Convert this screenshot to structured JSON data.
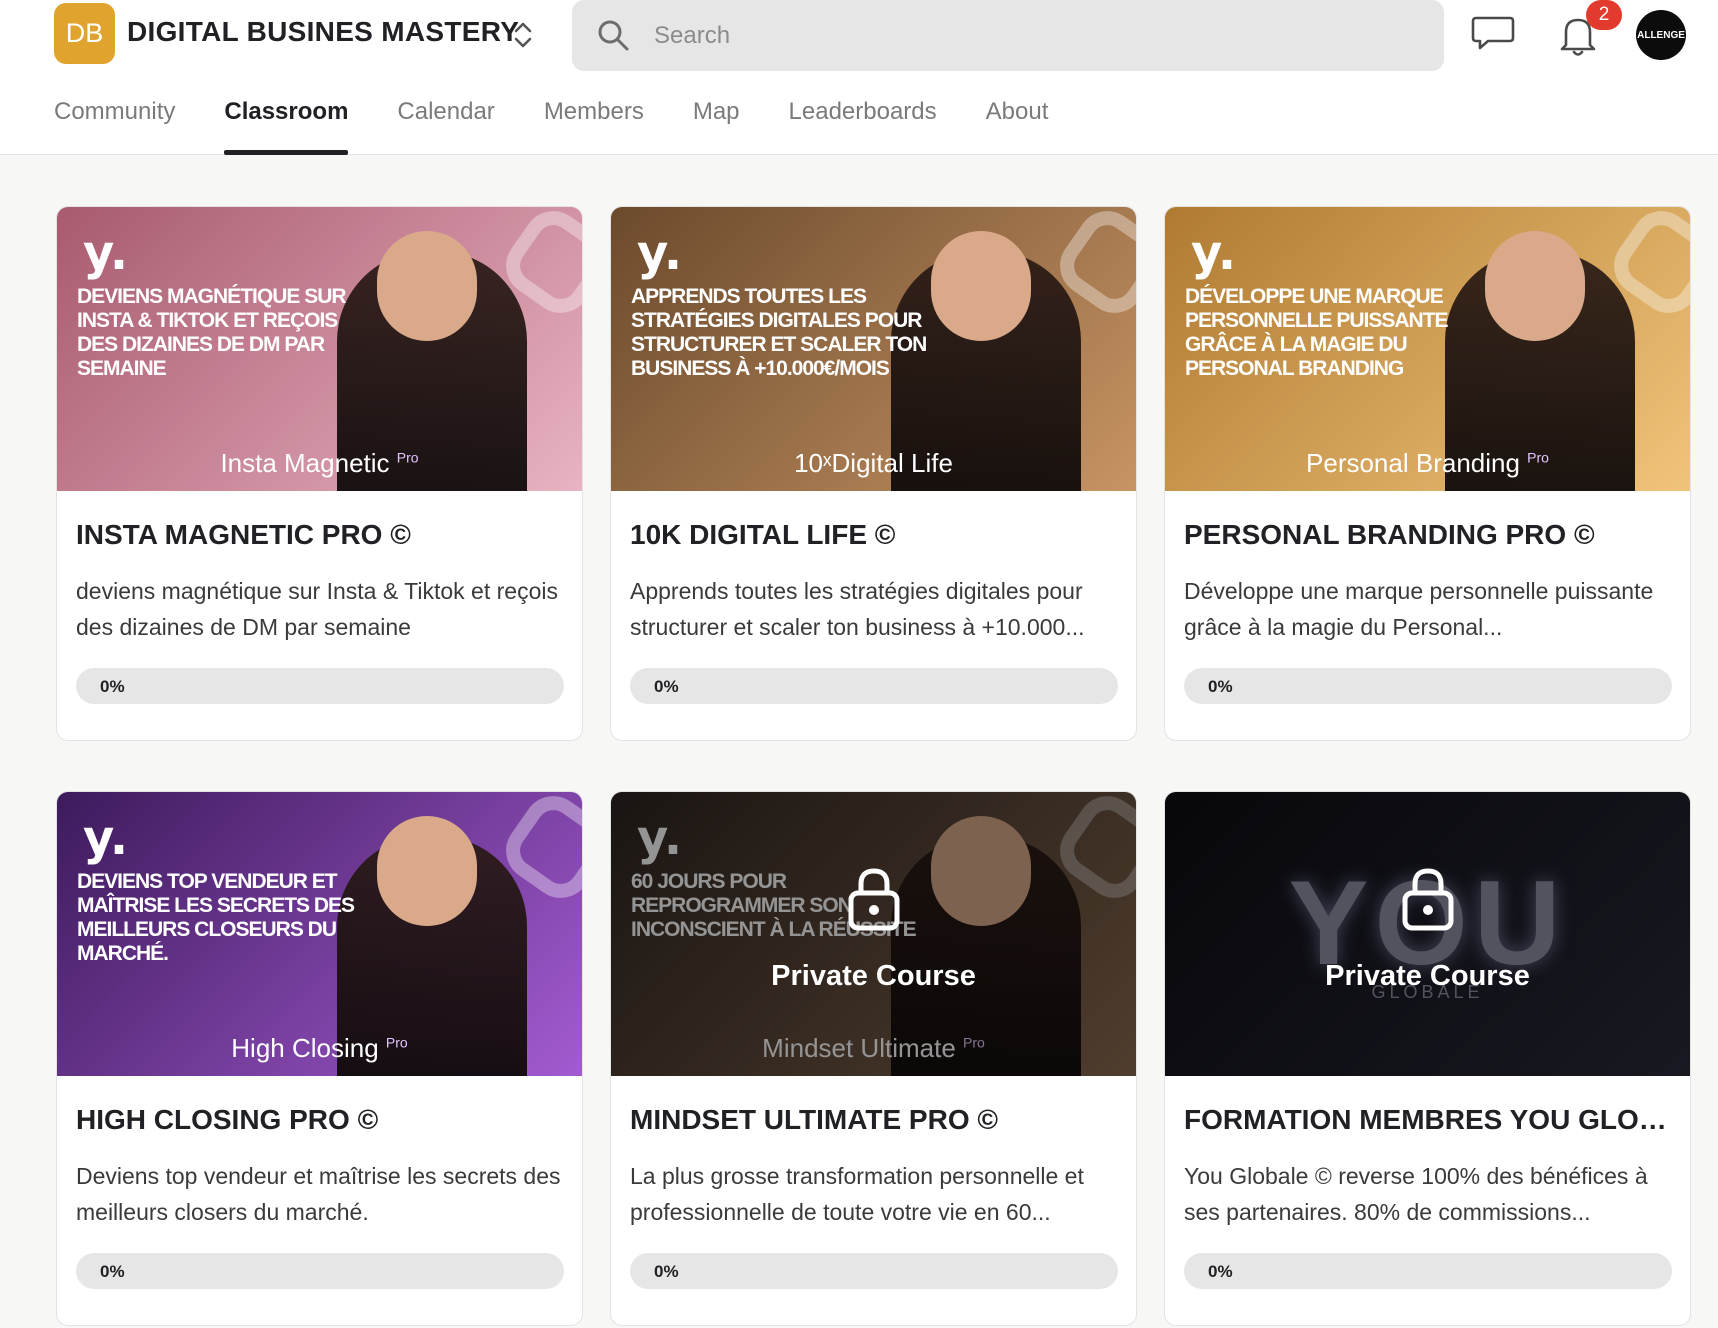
{
  "header": {
    "logo_initials": "DB",
    "group_name": "DIGITAL BUSINES MASTERY",
    "search_placeholder": "Search",
    "notification_count": "2",
    "avatar_text": "ALLENGE"
  },
  "tabs": [
    {
      "label": "Community",
      "active": false
    },
    {
      "label": "Classroom",
      "active": true
    },
    {
      "label": "Calendar",
      "active": false
    },
    {
      "label": "Members",
      "active": false
    },
    {
      "label": "Map",
      "active": false
    },
    {
      "label": "Leaderboards",
      "active": false
    },
    {
      "label": "About",
      "active": false
    }
  ],
  "courses": [
    {
      "title": "INSTA MAGNETIC PRO ©",
      "description": "deviens magnétique sur Insta & Tiktok et reçois des dizaines de DM par semaine",
      "progress_label": "0%",
      "progress": 0,
      "cover_headline": "DEVIENS MAGNÉTIQUE SUR INSTA & TIKTOK ET REÇOIS DES DIZAINES DE DM PAR SEMAINE",
      "cover_product": "Insta Magnetic",
      "cover_product_sup": "Pro",
      "cover_brand": "y.",
      "locked": false,
      "gradient": [
        "#a85a6e",
        "#e8b3c2"
      ]
    },
    {
      "title": "10K DIGITAL LIFE ©",
      "description": "Apprends toutes les stratégies digitales pour structurer et scaler ton business à +10.000...",
      "progress_label": "0%",
      "progress": 0,
      "cover_headline": "APPRENDS TOUTES LES STRATÉGIES DIGITALES POUR STRUCTURER ET SCALER TON BUSINESS À +10.000€/MOIS",
      "cover_product": "10ˣDigital Life",
      "cover_product_sup": "",
      "cover_brand": "y.",
      "locked": false,
      "gradient": [
        "#6b4a2c",
        "#c79464"
      ]
    },
    {
      "title": "PERSONAL BRANDING PRO ©",
      "description": "Développe une marque personnelle puissante grâce à la magie du Personal...",
      "progress_label": "0%",
      "progress": 0,
      "cover_headline": "DÉVELOPPE UNE MARQUE PERSONNELLE PUISSANTE GRÂCE À LA MAGIE DU PERSONAL BRANDING",
      "cover_product": "Personal Branding",
      "cover_product_sup": "Pro",
      "cover_brand": "y.",
      "locked": false,
      "gradient": [
        "#b07a32",
        "#f0c47a"
      ]
    },
    {
      "title": "HIGH CLOSING PRO ©",
      "description": "Deviens top vendeur et maîtrise les secrets des meilleurs closers du marché.",
      "progress_label": "0%",
      "progress": 0,
      "cover_headline": "DEVIENS TOP VENDEUR ET MAÎTRISE LES SECRETS DES MEILLEURS CLOSEURS DU MARCHÉ.",
      "cover_product": "High Closing",
      "cover_product_sup": "Pro",
      "cover_brand": "y.",
      "locked": false,
      "gradient": [
        "#3d1a5c",
        "#a35bd1"
      ]
    },
    {
      "title": "MINDSET ULTIMATE PRO ©",
      "description": "La plus grosse transformation personnelle et professionnelle de toute votre vie en 60...",
      "progress_label": "0%",
      "progress": 0,
      "cover_headline": "60 JOURS POUR REPROGRAMMER SON INCONSCIENT À LA RÉUSSITE",
      "cover_product": "Mindset Ultimate",
      "cover_product_sup": "Pro",
      "cover_brand": "y.",
      "locked": true,
      "locked_label": "Private Course",
      "gradient": [
        "#2c2420",
        "#8a6a50"
      ]
    },
    {
      "title": "FORMATION MEMBRES YOU GLO…",
      "description": "You Globale © reverse 100% des bénéfices à ses partenaires. 80% de commissions...",
      "progress_label": "0%",
      "progress": 0,
      "cover_headline": "",
      "cover_product": "",
      "cover_product_sup": "",
      "cover_brand": "YOU",
      "cover_sub": "GLOBALE",
      "locked": true,
      "locked_label": "Private Course",
      "gradient": [
        "#0d0d14",
        "#2a2b3a"
      ]
    }
  ]
}
